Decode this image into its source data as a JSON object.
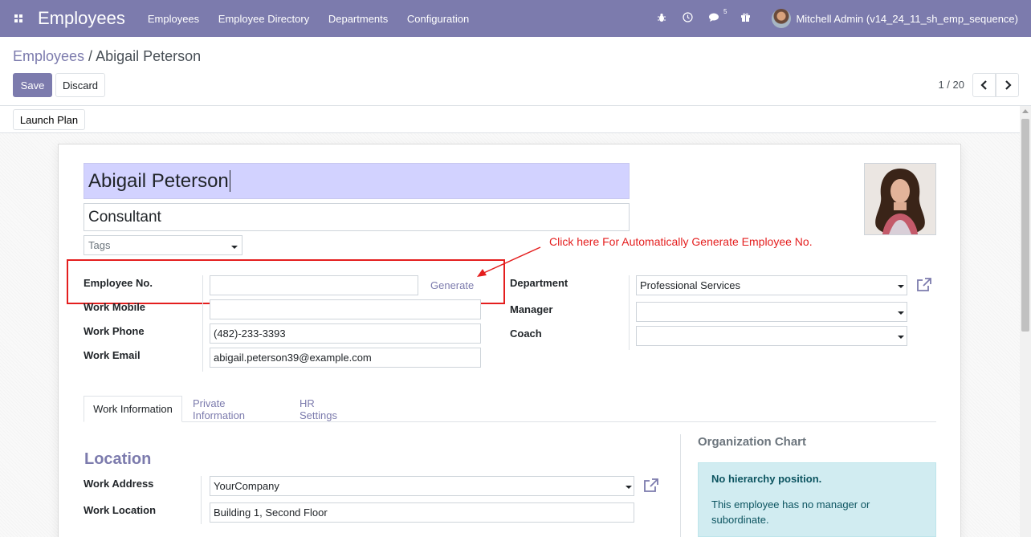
{
  "navbar": {
    "app_title": "Employees",
    "menu": [
      "Employees",
      "Employee Directory",
      "Departments",
      "Configuration"
    ],
    "messages_count": "5",
    "user_name": "Mitchell Admin (v14_24_11_sh_emp_sequence)"
  },
  "breadcrumb": {
    "parent": "Employees",
    "separator": " / ",
    "current": "Abigail Peterson"
  },
  "buttons": {
    "save": "Save",
    "discard": "Discard",
    "launch_plan": "Launch Plan"
  },
  "pager": {
    "value": "1 / 20"
  },
  "employee": {
    "name": "Abigail Peterson",
    "job_title": "Consultant",
    "tags_placeholder": "Tags"
  },
  "fields": {
    "employee_no": {
      "label": "Employee No.",
      "value": "",
      "action": "Generate"
    },
    "work_mobile": {
      "label": "Work Mobile",
      "value": ""
    },
    "work_phone": {
      "label": "Work Phone",
      "value": "(482)-233-3393"
    },
    "work_email": {
      "label": "Work Email",
      "value": "abigail.peterson39@example.com"
    },
    "department": {
      "label": "Department",
      "value": "Professional Services"
    },
    "manager": {
      "label": "Manager",
      "value": ""
    },
    "coach": {
      "label": "Coach",
      "value": ""
    }
  },
  "annotation": {
    "text": "Click here For Automatically Generate Employee No.",
    "color": "#e41e1e"
  },
  "tabs": [
    "Work Information",
    "Private Information",
    "HR Settings"
  ],
  "location": {
    "title": "Location",
    "work_address": {
      "label": "Work Address",
      "value": "YourCompany"
    },
    "work_location": {
      "label": "Work Location",
      "value": "Building 1, Second Floor"
    }
  },
  "org_chart": {
    "title": "Organization Chart",
    "alert_title": "No hierarchy position.",
    "alert_text": "This employee has no manager or subordinate."
  },
  "colors": {
    "brand": "#7c7bad",
    "name_highlight": "#d2d2ff",
    "alert_bg": "#d1ecf1"
  }
}
